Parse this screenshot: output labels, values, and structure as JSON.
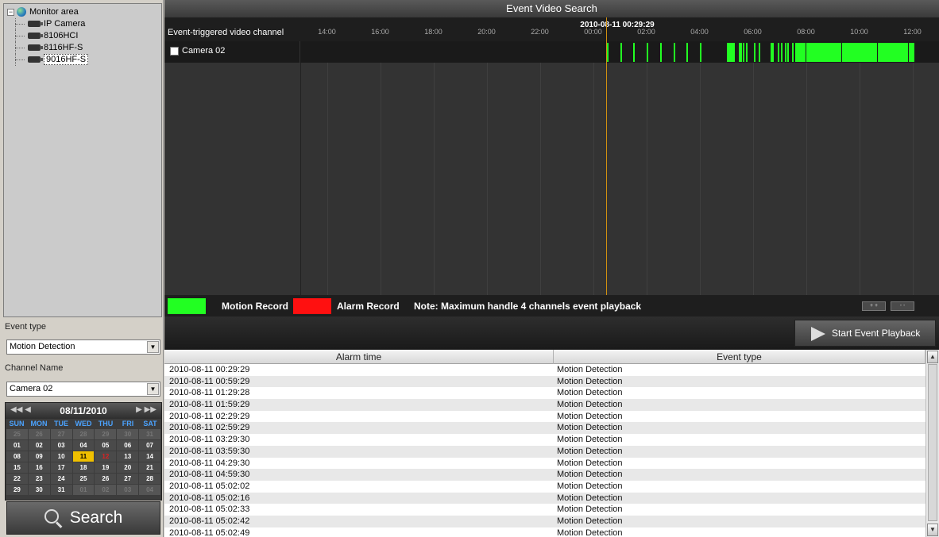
{
  "tree": {
    "root_label": "Monitor area",
    "expander_symbol": "−",
    "devices": [
      {
        "label": "IP Camera"
      },
      {
        "label": "8106HCI"
      },
      {
        "label": "8116HF-S"
      },
      {
        "label": "9016HF-S",
        "selected": true
      }
    ]
  },
  "filters": {
    "event_type_label": "Event type",
    "event_type_value": "Motion Detection",
    "channel_name_label": "Channel Name",
    "channel_name_value": "Camera 02",
    "dropdown_symbol": "▼"
  },
  "calendar": {
    "title": "08/11/2010",
    "prev_symbol": "◀◀ ◀",
    "next_symbol": "▶ ▶▶",
    "day_names": [
      "SUN",
      "MON",
      "TUE",
      "WED",
      "THU",
      "FRI",
      "SAT"
    ],
    "cells": [
      {
        "d": "25",
        "other": true
      },
      {
        "d": "26",
        "other": true
      },
      {
        "d": "27",
        "other": true
      },
      {
        "d": "28",
        "other": true
      },
      {
        "d": "29",
        "other": true
      },
      {
        "d": "30",
        "other": true
      },
      {
        "d": "31",
        "other": true
      },
      {
        "d": "01"
      },
      {
        "d": "02"
      },
      {
        "d": "03"
      },
      {
        "d": "04"
      },
      {
        "d": "05"
      },
      {
        "d": "06"
      },
      {
        "d": "07"
      },
      {
        "d": "08"
      },
      {
        "d": "09"
      },
      {
        "d": "10"
      },
      {
        "d": "11",
        "selected": true
      },
      {
        "d": "12",
        "red": true
      },
      {
        "d": "13"
      },
      {
        "d": "14"
      },
      {
        "d": "15"
      },
      {
        "d": "16"
      },
      {
        "d": "17"
      },
      {
        "d": "18"
      },
      {
        "d": "19"
      },
      {
        "d": "20"
      },
      {
        "d": "21"
      },
      {
        "d": "22"
      },
      {
        "d": "23"
      },
      {
        "d": "24"
      },
      {
        "d": "25"
      },
      {
        "d": "26"
      },
      {
        "d": "27"
      },
      {
        "d": "28"
      },
      {
        "d": "29"
      },
      {
        "d": "30"
      },
      {
        "d": "31"
      },
      {
        "d": "01",
        "other": true
      },
      {
        "d": "02",
        "other": true
      },
      {
        "d": "03",
        "other": true
      },
      {
        "d": "04",
        "other": true
      }
    ]
  },
  "search_label": "Search",
  "title": "Event Video Search",
  "timeline": {
    "channel_header": "Event-triggered video channel",
    "current_time": "2010-08-11 00:29:29",
    "cursor_time": "00:29",
    "ticks": [
      "14:00",
      "16:00",
      "18:00",
      "20:00",
      "22:00",
      "00:00",
      "02:00",
      "04:00",
      "06:00",
      "08:00",
      "10:00",
      "12:00"
    ],
    "motion_segments": [
      [
        "00:32",
        "00:33"
      ],
      [
        "01:02",
        "01:03"
      ],
      [
        "01:31",
        "01:32"
      ],
      [
        "02:01",
        "02:02"
      ],
      [
        "02:31",
        "02:32"
      ],
      [
        "03:01",
        "03:02"
      ],
      [
        "03:31",
        "03:32"
      ],
      [
        "04:01",
        "04:02"
      ],
      [
        "05:02",
        "05:20"
      ],
      [
        "05:28",
        "05:30"
      ],
      [
        "05:33",
        "05:35"
      ],
      [
        "05:38",
        "05:40"
      ],
      [
        "05:44",
        "05:46"
      ],
      [
        "06:02",
        "06:03"
      ],
      [
        "06:14",
        "06:17"
      ],
      [
        "06:40",
        "06:48"
      ],
      [
        "06:56",
        "06:57"
      ],
      [
        "07:04",
        "07:08"
      ],
      [
        "07:12",
        "07:13"
      ],
      [
        "07:18",
        "07:22"
      ],
      [
        "07:28",
        "07:30"
      ],
      [
        "07:35",
        "07:36"
      ],
      [
        "07:40",
        "08:00"
      ],
      [
        "08:00",
        "09:20"
      ],
      [
        "09:22",
        "10:40"
      ],
      [
        "10:42",
        "11:50"
      ],
      [
        "11:52",
        "12:05"
      ]
    ]
  },
  "camera": {
    "label": "Camera 02"
  },
  "legend": {
    "motion_label": "Motion Record",
    "alarm_label": "Alarm Record",
    "note": "Note: Maximum handle 4 channels event playback",
    "motion_color": "#22ff22",
    "alarm_color": "#ff1010",
    "zoom_in_symbol": "+ +",
    "zoom_out_symbol": "- -"
  },
  "playback_label": "Start Event Playback",
  "table": {
    "columns": [
      "Alarm time",
      "Event type"
    ],
    "rows": [
      [
        "2010-08-11 00:29:29",
        "Motion Detection"
      ],
      [
        "2010-08-11 00:59:29",
        "Motion Detection"
      ],
      [
        "2010-08-11 01:29:28",
        "Motion Detection"
      ],
      [
        "2010-08-11 01:59:29",
        "Motion Detection"
      ],
      [
        "2010-08-11 02:29:29",
        "Motion Detection"
      ],
      [
        "2010-08-11 02:59:29",
        "Motion Detection"
      ],
      [
        "2010-08-11 03:29:30",
        "Motion Detection"
      ],
      [
        "2010-08-11 03:59:30",
        "Motion Detection"
      ],
      [
        "2010-08-11 04:29:30",
        "Motion Detection"
      ],
      [
        "2010-08-11 04:59:30",
        "Motion Detection"
      ],
      [
        "2010-08-11 05:02:02",
        "Motion Detection"
      ],
      [
        "2010-08-11 05:02:16",
        "Motion Detection"
      ],
      [
        "2010-08-11 05:02:33",
        "Motion Detection"
      ],
      [
        "2010-08-11 05:02:42",
        "Motion Detection"
      ],
      [
        "2010-08-11 05:02:49",
        "Motion Detection"
      ]
    ],
    "scroll_up_symbol": "▲",
    "scroll_down_symbol": "▼"
  }
}
